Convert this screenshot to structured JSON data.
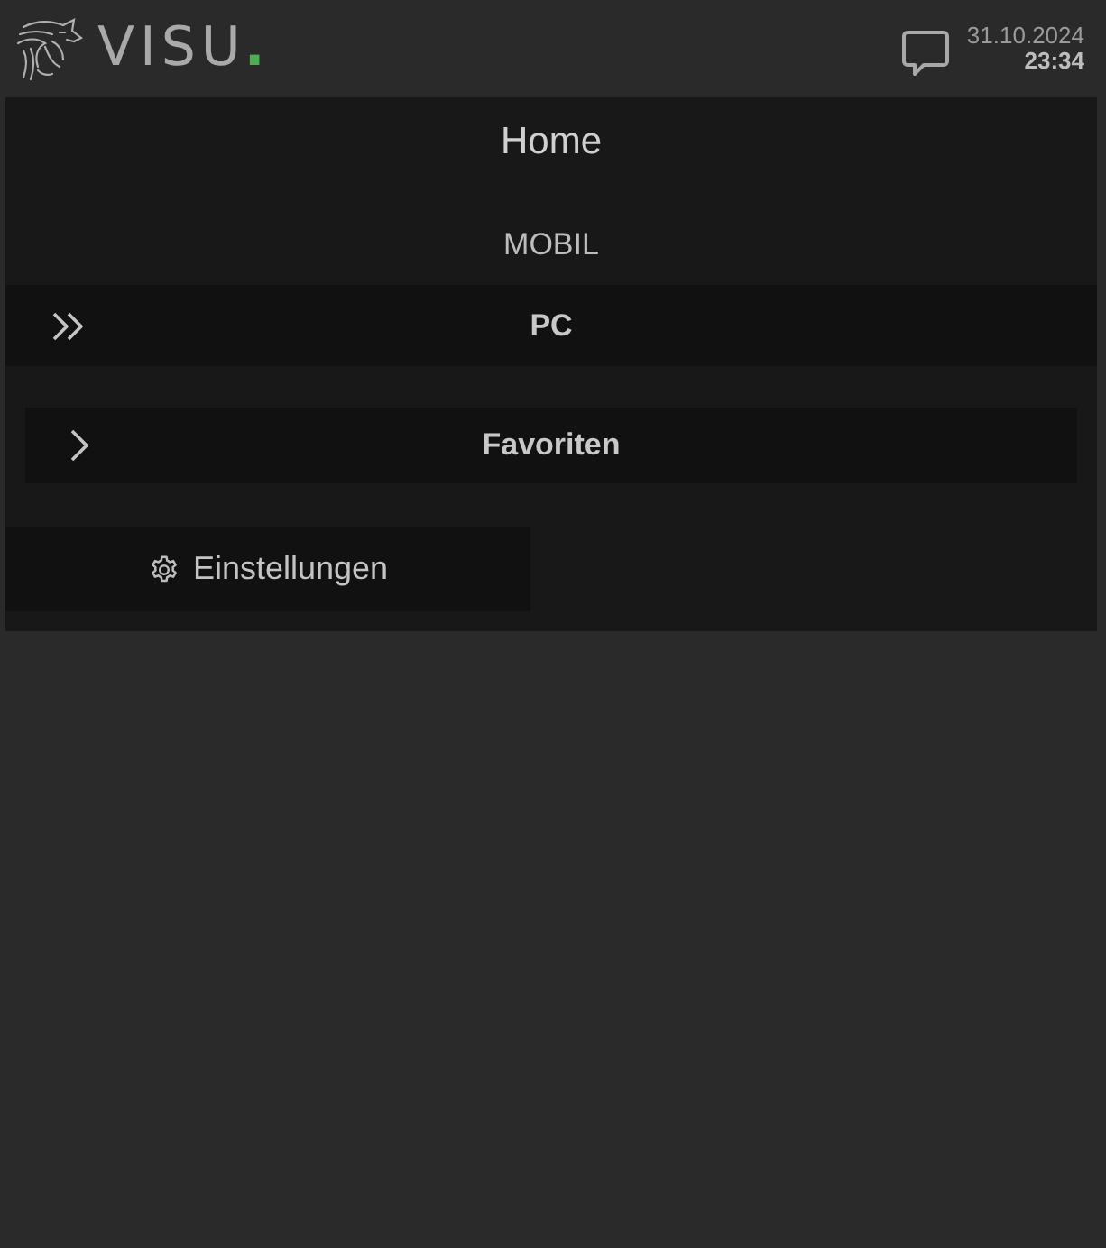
{
  "header": {
    "logo": {
      "text": "VISU",
      "dot": "."
    },
    "date": "31.10.2024",
    "time": "23:34"
  },
  "page": {
    "title": "Home",
    "section": "MOBIL",
    "items": [
      {
        "kind": "link",
        "label": "PC"
      },
      {
        "kind": "group",
        "label": "Favoriten"
      }
    ],
    "settings_button": {
      "label": "Einstellungen"
    }
  }
}
